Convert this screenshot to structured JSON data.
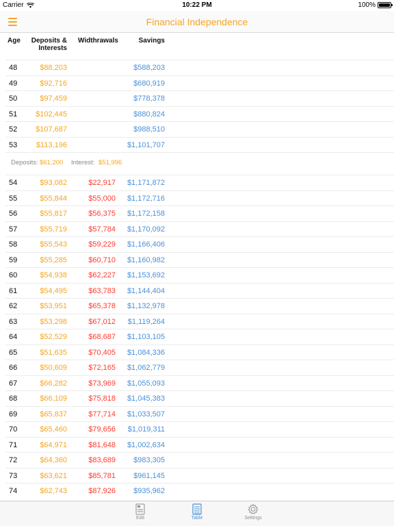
{
  "status": {
    "carrier": "Carrier",
    "time": "10:22 PM",
    "battery": "100%"
  },
  "nav": {
    "title": "Financial Independence"
  },
  "table": {
    "headers": {
      "age": "Age",
      "deposits_line1": "Deposits &",
      "deposits_line2": "Interests",
      "withdrawals": "Widthrawals",
      "savings": "Savings"
    },
    "rows_before": [
      {
        "age": "48",
        "deposits": "$88,203",
        "withdrawals": "",
        "savings": "$588,203"
      },
      {
        "age": "49",
        "deposits": "$92,716",
        "withdrawals": "",
        "savings": "$680,919"
      },
      {
        "age": "50",
        "deposits": "$97,459",
        "withdrawals": "",
        "savings": "$778,378"
      },
      {
        "age": "51",
        "deposits": "$102,445",
        "withdrawals": "",
        "savings": "$880,824"
      },
      {
        "age": "52",
        "deposits": "$107,687",
        "withdrawals": "",
        "savings": "$988,510"
      },
      {
        "age": "53",
        "deposits": "$113,196",
        "withdrawals": "",
        "savings": "$1,101,707"
      }
    ],
    "summary": {
      "deposits_label": "Deposits:",
      "deposits_value": "$61,200",
      "interest_label": "Interest:",
      "interest_value": "$51,996"
    },
    "rows_after": [
      {
        "age": "54",
        "deposits": "$93,082",
        "withdrawals": "$22,917",
        "savings": "$1,171,872"
      },
      {
        "age": "55",
        "deposits": "$55,844",
        "withdrawals": "$55,000",
        "savings": "$1,172,716"
      },
      {
        "age": "56",
        "deposits": "$55,817",
        "withdrawals": "$56,375",
        "savings": "$1,172,158"
      },
      {
        "age": "57",
        "deposits": "$55,719",
        "withdrawals": "$57,784",
        "savings": "$1,170,092"
      },
      {
        "age": "58",
        "deposits": "$55,543",
        "withdrawals": "$59,229",
        "savings": "$1,166,406"
      },
      {
        "age": "59",
        "deposits": "$55,285",
        "withdrawals": "$60,710",
        "savings": "$1,160,982"
      },
      {
        "age": "60",
        "deposits": "$54,938",
        "withdrawals": "$62,227",
        "savings": "$1,153,692"
      },
      {
        "age": "61",
        "deposits": "$54,495",
        "withdrawals": "$63,783",
        "savings": "$1,144,404"
      },
      {
        "age": "62",
        "deposits": "$53,951",
        "withdrawals": "$65,378",
        "savings": "$1,132,978"
      },
      {
        "age": "63",
        "deposits": "$53,298",
        "withdrawals": "$67,012",
        "savings": "$1,119,264"
      },
      {
        "age": "64",
        "deposits": "$52,529",
        "withdrawals": "$68,687",
        "savings": "$1,103,105"
      },
      {
        "age": "65",
        "deposits": "$51,635",
        "withdrawals": "$70,405",
        "savings": "$1,084,336"
      },
      {
        "age": "66",
        "deposits": "$50,609",
        "withdrawals": "$72,165",
        "savings": "$1,062,779"
      },
      {
        "age": "67",
        "deposits": "$66,282",
        "withdrawals": "$73,969",
        "savings": "$1,055,093"
      },
      {
        "age": "68",
        "deposits": "$66,109",
        "withdrawals": "$75,818",
        "savings": "$1,045,383"
      },
      {
        "age": "69",
        "deposits": "$65,837",
        "withdrawals": "$77,714",
        "savings": "$1,033,507"
      },
      {
        "age": "70",
        "deposits": "$65,460",
        "withdrawals": "$79,656",
        "savings": "$1,019,311"
      },
      {
        "age": "71",
        "deposits": "$64,971",
        "withdrawals": "$81,648",
        "savings": "$1,002,634"
      },
      {
        "age": "72",
        "deposits": "$64,360",
        "withdrawals": "$83,689",
        "savings": "$983,305"
      },
      {
        "age": "73",
        "deposits": "$63,621",
        "withdrawals": "$85,781",
        "savings": "$961,145"
      },
      {
        "age": "74",
        "deposits": "$62,743",
        "withdrawals": "$87,926",
        "savings": "$935,962"
      }
    ]
  },
  "tabs": [
    {
      "label": "Edit",
      "icon": "document-icon",
      "active": false
    },
    {
      "label": "Table",
      "icon": "list-icon",
      "active": true
    },
    {
      "label": "Settings",
      "icon": "gear-icon",
      "active": false
    }
  ],
  "colors": {
    "accent": "#f5a623",
    "withdrawal": "#ff3b30",
    "savings": "#4a90d9",
    "tab_active": "#4a90d9",
    "tab_inactive": "#8e8e93"
  }
}
